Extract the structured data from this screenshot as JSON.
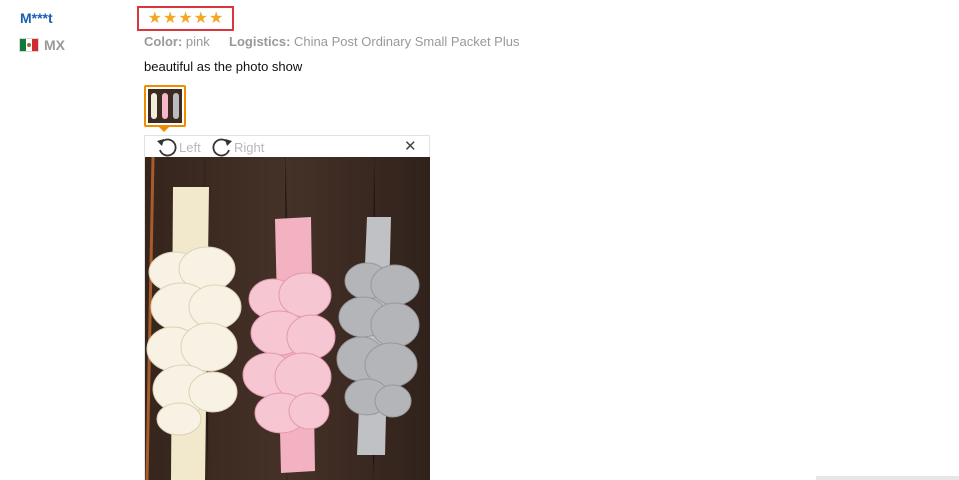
{
  "review": {
    "reviewer": {
      "name": "M***t",
      "country_code": "MX",
      "flag_icon": "mexico-flag-icon"
    },
    "rating": {
      "stars": 5,
      "max": 5,
      "star_symbol": "★",
      "color": "#f5a623",
      "highlight_color": "#d9363e"
    },
    "attributes": {
      "color_label": "Color:",
      "color_value": "pink",
      "logistics_label": "Logistics:",
      "logistics_value": "China Post Ordinary Small Packet Plus"
    },
    "text": "beautiful as the photo show",
    "thumbnail_icon": "review-photo-thumbnail",
    "accent_color": "#f08c00"
  },
  "viewer": {
    "rotate_left_label": "Left",
    "rotate_right_label": "Right",
    "rotate_left_icon": "rotate-left-icon",
    "rotate_right_icon": "rotate-right-icon",
    "close_symbol": "✕",
    "close_icon": "close-icon",
    "photo": {
      "subject": "three chiffon flower baby headbands",
      "headband_colors": [
        "cream",
        "pink",
        "gray"
      ]
    }
  }
}
